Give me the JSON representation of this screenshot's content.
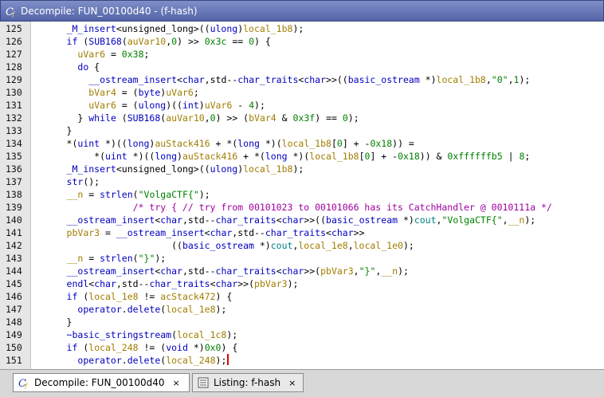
{
  "window": {
    "title": "Decompile: FUN_00100d40 -  (f-hash)"
  },
  "tabs": [
    {
      "label": "Decompile: FUN_00100d40",
      "close": "×",
      "active": true
    },
    {
      "label": "Listing:  f-hash",
      "close": "×",
      "active": false
    }
  ],
  "code_lines": [
    {
      "num": "125",
      "text": "      _M_insert<unsigned_long>((ulong)local_1b8);"
    },
    {
      "num": "126",
      "text": "      if (SUB168(auVar10,0) >> 0x3c == 0) {"
    },
    {
      "num": "127",
      "text": "        uVar6 = 0x38;"
    },
    {
      "num": "128",
      "text": "        do {"
    },
    {
      "num": "129",
      "text": "          __ostream_insert<char,std--char_traits<char>>((basic_ostream *)local_1b8,\"0\",1);"
    },
    {
      "num": "130",
      "text": "          bVar4 = (byte)uVar6;"
    },
    {
      "num": "131",
      "text": "          uVar6 = (ulong)((int)uVar6 - 4);"
    },
    {
      "num": "132",
      "text": "        } while (SUB168(auVar10,0) >> (bVar4 & 0x3f) == 0);"
    },
    {
      "num": "133",
      "text": "      }"
    },
    {
      "num": "134",
      "text": "      *(uint *)((long)auStack416 + *(long *)(local_1b8[0] + -0x18)) ="
    },
    {
      "num": "135",
      "text": "           *(uint *)((long)auStack416 + *(long *)(local_1b8[0] + -0x18)) & 0xffffffb5 | 8;"
    },
    {
      "num": "136",
      "text": "      _M_insert<unsigned_long>((ulong)local_1b8);"
    },
    {
      "num": "137",
      "text": "      str();"
    },
    {
      "num": "138",
      "text": "      __n = strlen(\"VolgaCTF{\");"
    },
    {
      "num": "139",
      "text": "                  /* try { // try from 00101023 to 00101066 has its CatchHandler @ 0010111a */"
    },
    {
      "num": "140",
      "text": "      __ostream_insert<char,std--char_traits<char>>((basic_ostream *)cout,\"VolgaCTF{\",__n);"
    },
    {
      "num": "141",
      "text": "      pbVar3 = __ostream_insert<char,std--char_traits<char>>"
    },
    {
      "num": "142",
      "text": "                         ((basic_ostream *)cout,local_1e8,local_1e0);"
    },
    {
      "num": "143",
      "text": "      __n = strlen(\"}\");"
    },
    {
      "num": "144",
      "text": "      __ostream_insert<char,std--char_traits<char>>(pbVar3,\"}\",__n);"
    },
    {
      "num": "145",
      "text": "      endl<char,std--char_traits<char>>(pbVar3);"
    },
    {
      "num": "146",
      "text": "      if (local_1e8 != acStack472) {"
    },
    {
      "num": "147",
      "text": "        operator.delete(local_1e8);"
    },
    {
      "num": "148",
      "text": "      }"
    },
    {
      "num": "149",
      "text": "      ~basic_stringstream(local_1c8);"
    },
    {
      "num": "150",
      "text": "      if (local_248 != (void *)0x0) {"
    },
    {
      "num": "151",
      "text": "        operator.delete(local_248);"
    }
  ],
  "colors": {
    "keyword": "#0000c0",
    "variable": "#a07d00",
    "number": "#008000",
    "comment": "#a000a0",
    "string": "#008080",
    "title_bar": "#5f6fb5"
  },
  "icons": {
    "title": "decompile-icon",
    "tab_decompile": "decompile-icon",
    "tab_listing": "listing-icon"
  }
}
